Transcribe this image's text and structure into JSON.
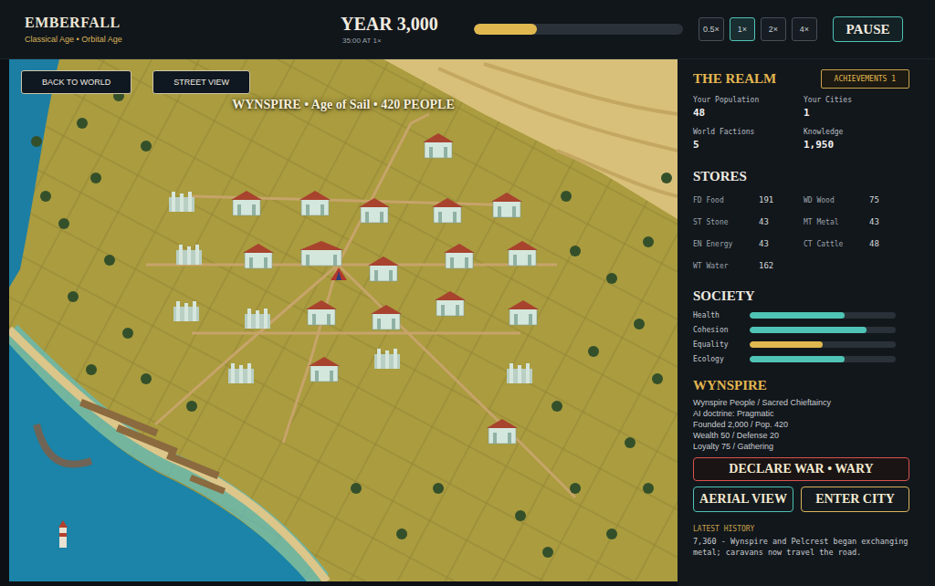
{
  "header": {
    "title": "EMBERFALL",
    "subtitle": "Classical Age • Orbital Age",
    "year": "YEAR 3,000",
    "clock": "35:00 AT 1×",
    "progress": {
      "level": 0.3
    },
    "speeds": [
      {
        "label": "0.5×",
        "selected": false
      },
      {
        "label": "1×",
        "selected": true
      },
      {
        "label": "2×",
        "selected": false
      },
      {
        "label": "4×",
        "selected": false
      }
    ],
    "pause": "PAUSE"
  },
  "map": {
    "buttons": [
      "BACK TO WORLD",
      "STREET VIEW"
    ],
    "title": "WYNSPIRE • Age of Sail • 420 PEOPLE"
  },
  "realm": {
    "title": "THE REALM",
    "achievements": "ACHIEVEMENTS 1",
    "stats": [
      {
        "label": "Your Population",
        "value": "48"
      },
      {
        "label": "Your Cities",
        "value": "1"
      },
      {
        "label": "World Factions",
        "value": "5"
      },
      {
        "label": "Knowledge",
        "value": "1,950"
      }
    ]
  },
  "stores": {
    "title": "STORES",
    "items": [
      {
        "label": "FD Food",
        "value": "191"
      },
      {
        "label": "WD Wood",
        "value": "75"
      },
      {
        "label": "ST Stone",
        "value": "43"
      },
      {
        "label": "MT Metal",
        "value": "43"
      },
      {
        "label": "EN Energy",
        "value": "43"
      },
      {
        "label": "CT Cattle",
        "value": "48"
      },
      {
        "label": "WT Water",
        "value": "162"
      }
    ]
  },
  "society": {
    "title": "SOCIETY",
    "meters": [
      {
        "label": "Health",
        "level": 0.65,
        "color": "#4fc3b5"
      },
      {
        "label": "Cohesion",
        "level": 0.8,
        "color": "#4fc3b5"
      },
      {
        "label": "Equality",
        "level": 0.5,
        "color": "#e0b84f"
      },
      {
        "label": "Ecology",
        "level": 0.65,
        "color": "#4fc3b5"
      }
    ]
  },
  "city": {
    "name": "WYNSPIRE",
    "lines": [
      "Wynspire People / Sacred Chieftaincy",
      "AI doctrine: Pragmatic",
      "Founded 2,000 / Pop. 420",
      "Wealth 50 / Defense 20",
      "Loyalty 75 / Gathering"
    ],
    "war": "DECLARE WAR • WARY",
    "aerial": "AERIAL VIEW",
    "enter": "ENTER CITY"
  },
  "history": {
    "title": "LATEST HISTORY",
    "entries": [
      "7,360 - Wynspire and Pelcrest began exchanging metal; caravans now travel the road."
    ]
  }
}
